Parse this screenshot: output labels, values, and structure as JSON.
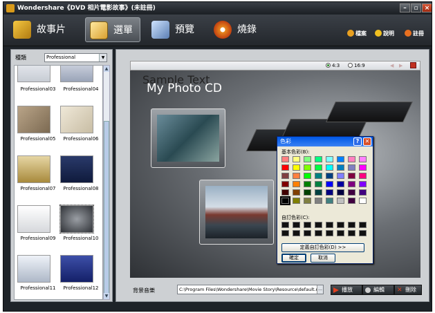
{
  "window": {
    "title": "Wondershare《DVD 相片電影故事》(未註冊)"
  },
  "toolbar": {
    "tabs": [
      {
        "label": "故事片"
      },
      {
        "label": "選單"
      },
      {
        "label": "預覽"
      },
      {
        "label": "燒錄"
      }
    ],
    "right": [
      {
        "label": "檔案"
      },
      {
        "label": "說明"
      },
      {
        "label": "註冊"
      }
    ]
  },
  "sidebar": {
    "category_label": "種類",
    "category_value": "Professional",
    "thumbnails": [
      {
        "label": "Professional03"
      },
      {
        "label": "Professional04"
      },
      {
        "label": "Professional05"
      },
      {
        "label": "Professional06"
      },
      {
        "label": "Professional07"
      },
      {
        "label": "Professional08"
      },
      {
        "label": "Professional09"
      },
      {
        "label": "Professional10"
      },
      {
        "label": "Professional11"
      },
      {
        "label": "Professional12"
      }
    ]
  },
  "preview": {
    "ratio_43": "4:3",
    "ratio_169": "16:9",
    "sample_text": "Sample Text",
    "title": "My Photo CD"
  },
  "footer": {
    "bgmusic_label": "背景音樂",
    "bgmusic_path": "C:\\Program Files\\Wondershare\\Movie Story\\Resource\\default.mp3",
    "play_label": "播放",
    "edit_label": "編輯",
    "delete_label": "刪除"
  },
  "color_dialog": {
    "title": "色彩",
    "basic_label": "基本色彩(B):",
    "custom_label": "自訂色彩(C):",
    "define_label": "定義自訂色彩(D) >>",
    "ok_label": "確定",
    "cancel_label": "取消",
    "basic_colors": [
      "#ff8080",
      "#ffff80",
      "#80ff80",
      "#00ff80",
      "#80ffff",
      "#0080ff",
      "#ff80c0",
      "#ff80ff",
      "#ff0000",
      "#ffff00",
      "#80ff00",
      "#00ff40",
      "#00ffff",
      "#0080c0",
      "#8080c0",
      "#ff00ff",
      "#804040",
      "#ff8040",
      "#00ff00",
      "#008080",
      "#004080",
      "#8080ff",
      "#800040",
      "#ff0080",
      "#800000",
      "#ff8000",
      "#008000",
      "#008040",
      "#0000ff",
      "#0000a0",
      "#800080",
      "#8000ff",
      "#400000",
      "#804000",
      "#004000",
      "#004040",
      "#000080",
      "#000040",
      "#400040",
      "#400080",
      "#000000",
      "#808000",
      "#808040",
      "#808080",
      "#408080",
      "#c0c0c0",
      "#400040",
      "#ffffff"
    ],
    "selected_index": 40
  }
}
